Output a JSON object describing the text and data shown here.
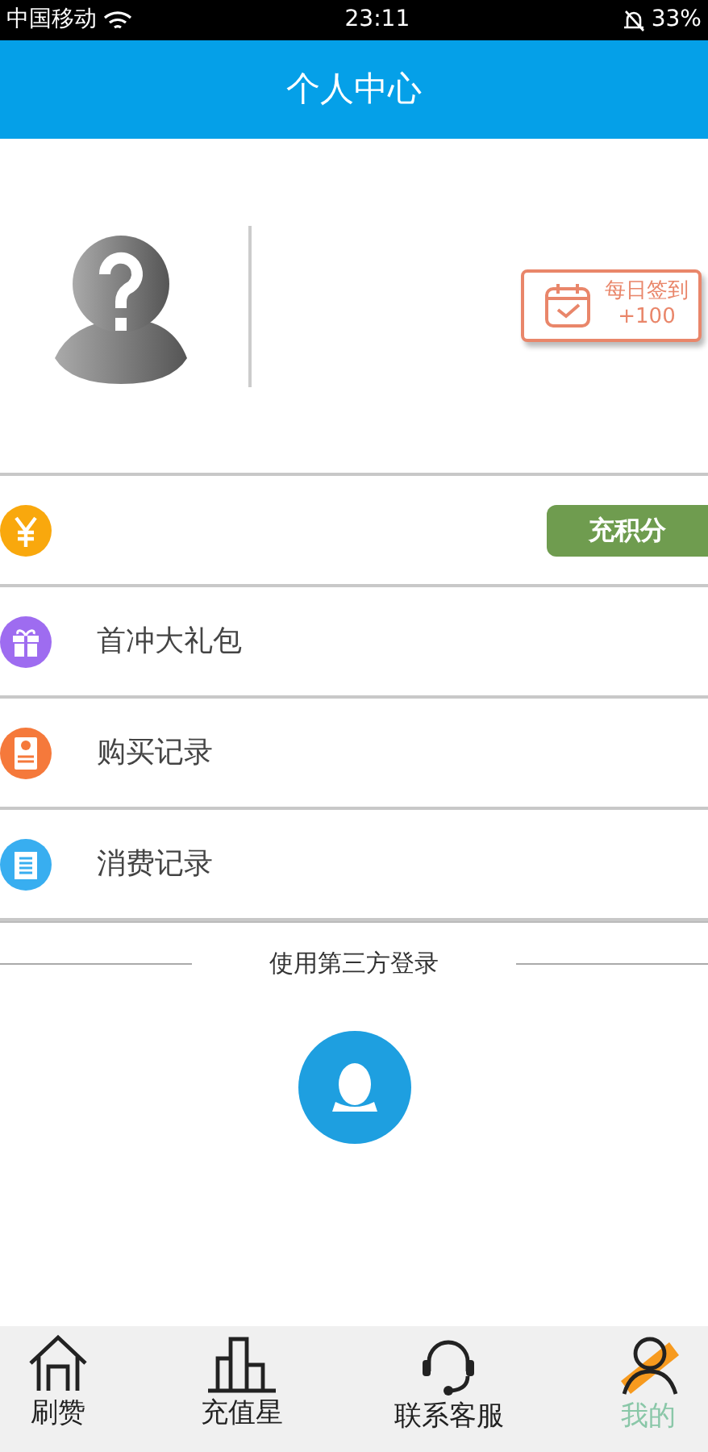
{
  "status_bar": {
    "carrier": "中国移动",
    "time": "23:11",
    "battery": "33%"
  },
  "header": {
    "title": "个人中心"
  },
  "checkin": {
    "label": "每日签到",
    "points": "+100"
  },
  "menu": [
    {
      "kind": "points",
      "button": "充积分"
    },
    {
      "kind": "link",
      "label": "首冲大礼包"
    },
    {
      "kind": "link",
      "label": "购买记录"
    },
    {
      "kind": "link",
      "label": "消费记录"
    }
  ],
  "third_party": {
    "label": "使用第三方登录"
  },
  "tabs": [
    {
      "label": "刷赞",
      "selected": false
    },
    {
      "label": "充值星",
      "selected": false
    },
    {
      "label": "联系客服",
      "selected": false
    },
    {
      "label": "我的",
      "selected": true
    }
  ]
}
